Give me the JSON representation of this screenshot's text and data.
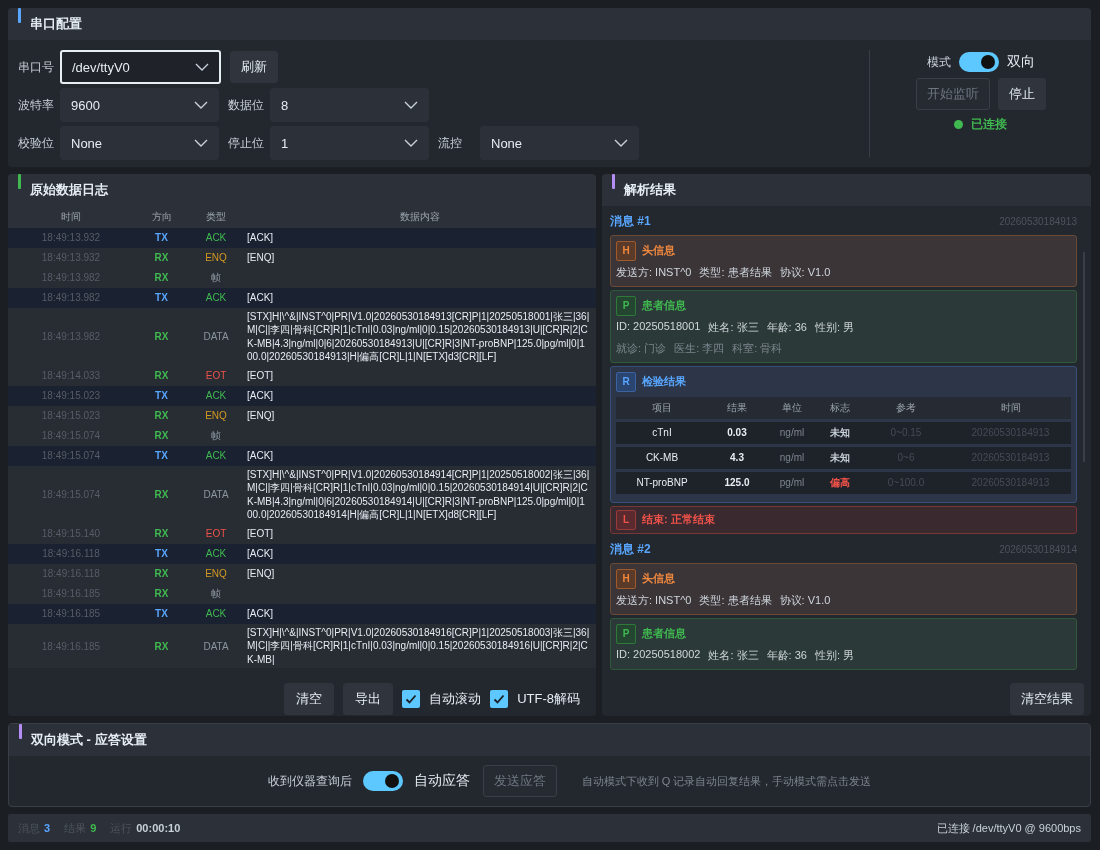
{
  "serial_config": {
    "title": "串口配置",
    "port": {
      "label": "串口号",
      "value": "/dev/ttyV0",
      "focused": true
    },
    "refresh_button": "刷新",
    "rows": [
      [
        {
          "label": "波特率",
          "value": "9600",
          "focused": false
        },
        {
          "label": "数据位",
          "value": "8",
          "focused": false
        }
      ],
      [
        {
          "label": "校验位",
          "value": "None",
          "focused": false
        },
        {
          "label": "停止位",
          "value": "1",
          "focused": false
        },
        {
          "label": "流控",
          "value": "None",
          "focused": false
        }
      ]
    ],
    "mode": {
      "label": "模式",
      "on": true,
      "value": "双向"
    },
    "start_button": {
      "label": "开始监听",
      "disabled": true
    },
    "stop_button": {
      "label": "停止",
      "disabled": false
    },
    "connection": {
      "connected": true,
      "text": "已连接"
    }
  },
  "log": {
    "title": "原始数据日志",
    "columns": [
      "时间",
      "方向",
      "类型",
      "数据内容"
    ],
    "rows": [
      {
        "time": "18:49:13.932",
        "direction": "TX",
        "type": "ACK",
        "kind": "ack",
        "outgoing": true,
        "content": "[ACK]"
      },
      {
        "time": "18:49:13.932",
        "direction": "RX",
        "type": "ENQ",
        "kind": "enq",
        "outgoing": false,
        "content": "[ENQ]"
      },
      {
        "time": "18:49:13.982",
        "direction": "RX",
        "type": "帧",
        "kind": "frame",
        "outgoing": false
      },
      {
        "time": "18:49:13.982",
        "direction": "TX",
        "type": "ACK",
        "kind": "ack",
        "outgoing": true,
        "content": "[ACK]"
      },
      {
        "time": "18:49:13.982",
        "direction": "RX",
        "type": "DATA",
        "kind": "data",
        "outgoing": false,
        "content": "[STX]H|\\^&|INST^0|PR|V1.0|20260530184913[CR]P|1|20250518001|张三|36|M|C||李四|骨科[CR]R|1|cTnI|0.03|ng/ml|0|0.15|20260530184913|U|[CR]R|2|CK-MB|4.3|ng/ml|0|6|20260530184913|U|[CR]R|3|NT-proBNP|125.0|pg/ml|0|100.0|20260530184913|H|偏高[CR]L|1|N[ETX]d3[CR][LF]"
      },
      {
        "time": "18:49:14.033",
        "direction": "RX",
        "type": "EOT",
        "kind": "eot",
        "outgoing": false,
        "content": "[EOT]"
      },
      {
        "time": "18:49:15.023",
        "direction": "TX",
        "type": "ACK",
        "kind": "ack",
        "outgoing": true,
        "content": "[ACK]"
      },
      {
        "time": "18:49:15.023",
        "direction": "RX",
        "type": "ENQ",
        "kind": "enq",
        "outgoing": false,
        "content": "[ENQ]"
      },
      {
        "time": "18:49:15.074",
        "direction": "RX",
        "type": "帧",
        "kind": "frame",
        "outgoing": false
      },
      {
        "time": "18:49:15.074",
        "direction": "TX",
        "type": "ACK",
        "kind": "ack",
        "outgoing": true,
        "content": "[ACK]"
      },
      {
        "time": "18:49:15.074",
        "direction": "RX",
        "type": "DATA",
        "kind": "data",
        "outgoing": false,
        "content": "[STX]H|\\^&|INST^0|PR|V1.0|20260530184914[CR]P|1|20250518002|张三|36|M|C||李四|骨科[CR]R|1|cTnI|0.03|ng/ml|0|0.15|20260530184914|U|[CR]R|2|CK-MB|4.3|ng/ml|0|6|20260530184914|U|[CR]R|3|NT-proBNP|125.0|pg/ml|0|100.0|20260530184914|H|偏高[CR]L|1|N[ETX]d8[CR][LF]"
      },
      {
        "time": "18:49:15.140",
        "direction": "RX",
        "type": "EOT",
        "kind": "eot",
        "outgoing": false,
        "content": "[EOT]"
      },
      {
        "time": "18:49:16.118",
        "direction": "TX",
        "type": "ACK",
        "kind": "ack",
        "outgoing": true,
        "content": "[ACK]"
      },
      {
        "time": "18:49:16.118",
        "direction": "RX",
        "type": "ENQ",
        "kind": "enq",
        "outgoing": false,
        "content": "[ENQ]"
      },
      {
        "time": "18:49:16.185",
        "direction": "RX",
        "type": "帧",
        "kind": "frame",
        "outgoing": false
      },
      {
        "time": "18:49:16.185",
        "direction": "TX",
        "type": "ACK",
        "kind": "ack",
        "outgoing": true,
        "content": "[ACK]"
      },
      {
        "time": "18:49:16.185",
        "direction": "RX",
        "type": "DATA",
        "kind": "data",
        "outgoing": false,
        "content": "[STX]H|\\^&|INST^0|PR|V1.0|20260530184916[CR]P|1|20250518003|张三|36|M|C||李四|骨科[CR]R|1|cTnI|0.03|ng/ml|0|0.15|20260530184916|U|[CR]R|2|CK-MB|"
      }
    ],
    "buttons": [
      "清空",
      "导出"
    ],
    "options": [
      {
        "label": "自动滚动",
        "checked": true
      },
      {
        "label": "UTF-8解码",
        "checked": true
      }
    ]
  },
  "results": {
    "title": "解析结果",
    "messages": [
      {
        "title": "消息 #1",
        "timestamp": "20260530184913",
        "segments": [
          {
            "kind": "header",
            "letter": "H",
            "title": "头信息",
            "fields": [
              "发送方: INST^0",
              "类型: 患者结果",
              "协议: V1.0"
            ]
          },
          {
            "kind": "patient",
            "letter": "P",
            "title": "患者信息",
            "fields": [
              "ID: 20250518001",
              "姓名: 张三",
              "年龄: 36",
              "性别: 男"
            ],
            "secondary_fields": [
              "就诊: 门诊",
              "医生: 李四",
              "科室: 骨科"
            ]
          },
          {
            "kind": "results",
            "letter": "R",
            "title": "检验结果",
            "columns": [
              "项目",
              "结果",
              "单位",
              "标志",
              "参考",
              "时间"
            ],
            "rows": [
              {
                "item": "cTnI",
                "result": "0.03",
                "unit": "ng/ml",
                "flag": "未知",
                "abnormal": false,
                "reference": "0~0.15",
                "time": "20260530184913"
              },
              {
                "item": "CK-MB",
                "result": "4.3",
                "unit": "ng/ml",
                "flag": "未知",
                "abnormal": false,
                "reference": "0~6",
                "time": "20260530184913"
              },
              {
                "item": "NT-proBNP",
                "result": "125.0",
                "unit": "pg/ml",
                "flag": "偏高",
                "abnormal": true,
                "reference": "0~100.0",
                "time": "20260530184913"
              }
            ]
          },
          {
            "kind": "end",
            "letter": "L",
            "title": "结束: 正常结束"
          }
        ]
      },
      {
        "title": "消息 #2",
        "timestamp": "20260530184914",
        "segments": [
          {
            "kind": "header",
            "letter": "H",
            "title": "头信息",
            "fields": [
              "发送方: INST^0",
              "类型: 患者结果",
              "协议: V1.0"
            ]
          },
          {
            "kind": "patient",
            "letter": "P",
            "title": "患者信息",
            "fields": [
              "ID: 20250518002",
              "姓名: 张三",
              "年龄: 36",
              "性别: 男"
            ]
          }
        ]
      }
    ],
    "clear_button": "清空结果"
  },
  "reply": {
    "title": "双向模式 - 应答设置",
    "label": "收到仪器查询后",
    "auto_reply": {
      "on": true,
      "label": "自动应答"
    },
    "send_button": {
      "label": "发送应答",
      "disabled": true
    },
    "hint": "自动模式下收到 Q 记录自动回复结果，手动模式需点击发送"
  },
  "status_bar": {
    "items": [
      {
        "label": "消息",
        "value": "3",
        "kind": "messages"
      },
      {
        "label": "结果",
        "value": "9",
        "kind": "results"
      },
      {
        "label": "运行",
        "value": "00:00:10",
        "kind": "runtime"
      }
    ],
    "connection": "已连接 /dev/ttyV0 @ 9600bps"
  }
}
